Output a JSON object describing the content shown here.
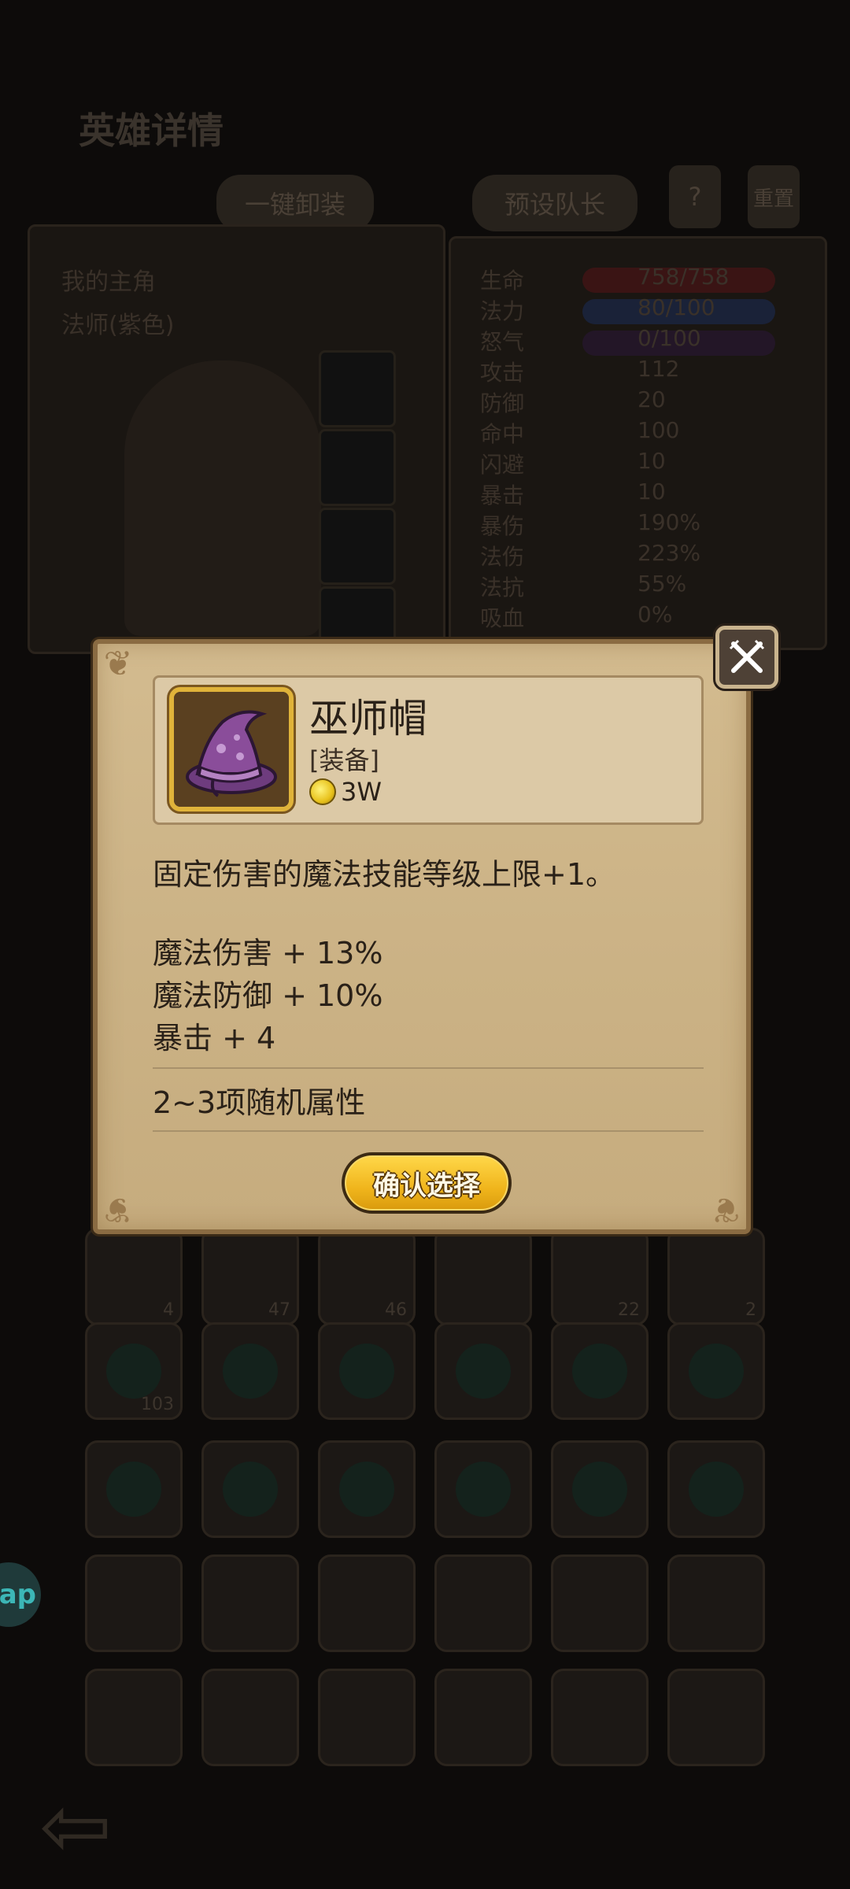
{
  "background": {
    "title": "英雄详情",
    "buttons": {
      "one_key_equip": "一键卸装",
      "preset_captain": "预设队长",
      "help": "?",
      "reset": "重置"
    },
    "hero_panel": {
      "name_line": "我的主角",
      "class_line": "法师(紫色)"
    },
    "stats": [
      {
        "label": "生命",
        "value": "758/758"
      },
      {
        "label": "法力",
        "value": "80/100"
      },
      {
        "label": "怒气",
        "value": "0/100"
      },
      {
        "label": "攻击",
        "value": "112"
      },
      {
        "label": "防御",
        "value": "20"
      },
      {
        "label": "命中",
        "value": "100"
      },
      {
        "label": "闪避",
        "value": "10"
      },
      {
        "label": "暴击",
        "value": "10"
      },
      {
        "label": "暴伤",
        "value": "190%"
      },
      {
        "label": "法伤",
        "value": "223%"
      },
      {
        "label": "法抗",
        "value": "55%"
      },
      {
        "label": "吸血",
        "value": "0%"
      }
    ],
    "inventory_counts": [
      "4",
      "47",
      "46",
      "22",
      "2",
      "103"
    ],
    "side_app_label": "ap"
  },
  "dialog": {
    "item": {
      "name": "巫师帽",
      "type": "[装备]",
      "price": "3W",
      "icon": "wizard-hat-icon"
    },
    "description": "固定伤害的魔法技能等级上限+1。",
    "attributes": [
      "魔法伤害 + 13%",
      "魔法防御 + 10%",
      "暴击 + 4"
    ],
    "random_attributes": "2~3项随机属性",
    "confirm_label": "确认选择",
    "close_icon": "crossed-swords-close-icon"
  },
  "colors": {
    "parchment": "#cdb487",
    "gold_button": "#f0b51c",
    "hat_purple": "#8a4d9a"
  }
}
